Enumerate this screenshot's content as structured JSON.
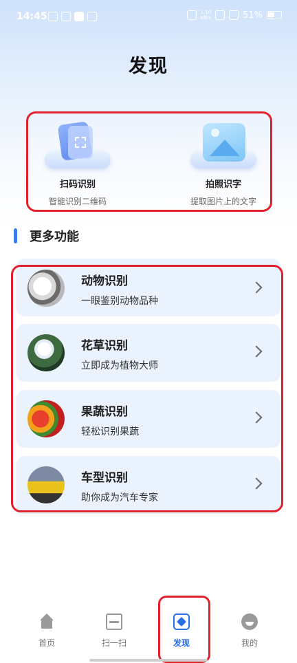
{
  "status_bar": {
    "time": "14:45",
    "net_speed_value": "1.10",
    "net_speed_unit": "KB/s",
    "battery": "51%"
  },
  "page": {
    "title": "发现"
  },
  "tools": [
    {
      "title": "扫码识别",
      "subtitle": "智能识别二维码",
      "icon": "qr-scan-icon"
    },
    {
      "title": "拍照识字",
      "subtitle": "提取图片上的文字",
      "icon": "photo-text-icon"
    }
  ],
  "section": {
    "label": "更多功能"
  },
  "features": [
    {
      "title": "动物识别",
      "subtitle": "一眼鉴别动物品种",
      "thumb": "puppy photo"
    },
    {
      "title": "花草识别",
      "subtitle": "立即成为植物大师",
      "thumb": "lily flower photo"
    },
    {
      "title": "果蔬识别",
      "subtitle": "轻松识别果蔬",
      "thumb": "fruit and vegetable photo"
    },
    {
      "title": "车型识别",
      "subtitle": "助你成为汽车专家",
      "thumb": "yellow sports car photo"
    }
  ],
  "tabbar": [
    {
      "label": "首页",
      "icon": "home-icon"
    },
    {
      "label": "扫一扫",
      "icon": "scan-icon"
    },
    {
      "label": "发现",
      "icon": "discover-icon",
      "active": true
    },
    {
      "label": "我的",
      "icon": "profile-icon"
    }
  ],
  "colors": {
    "accent": "#2c6fe0",
    "highlight_outline": "#e0202c",
    "card_bg": "#eaf2fd"
  }
}
